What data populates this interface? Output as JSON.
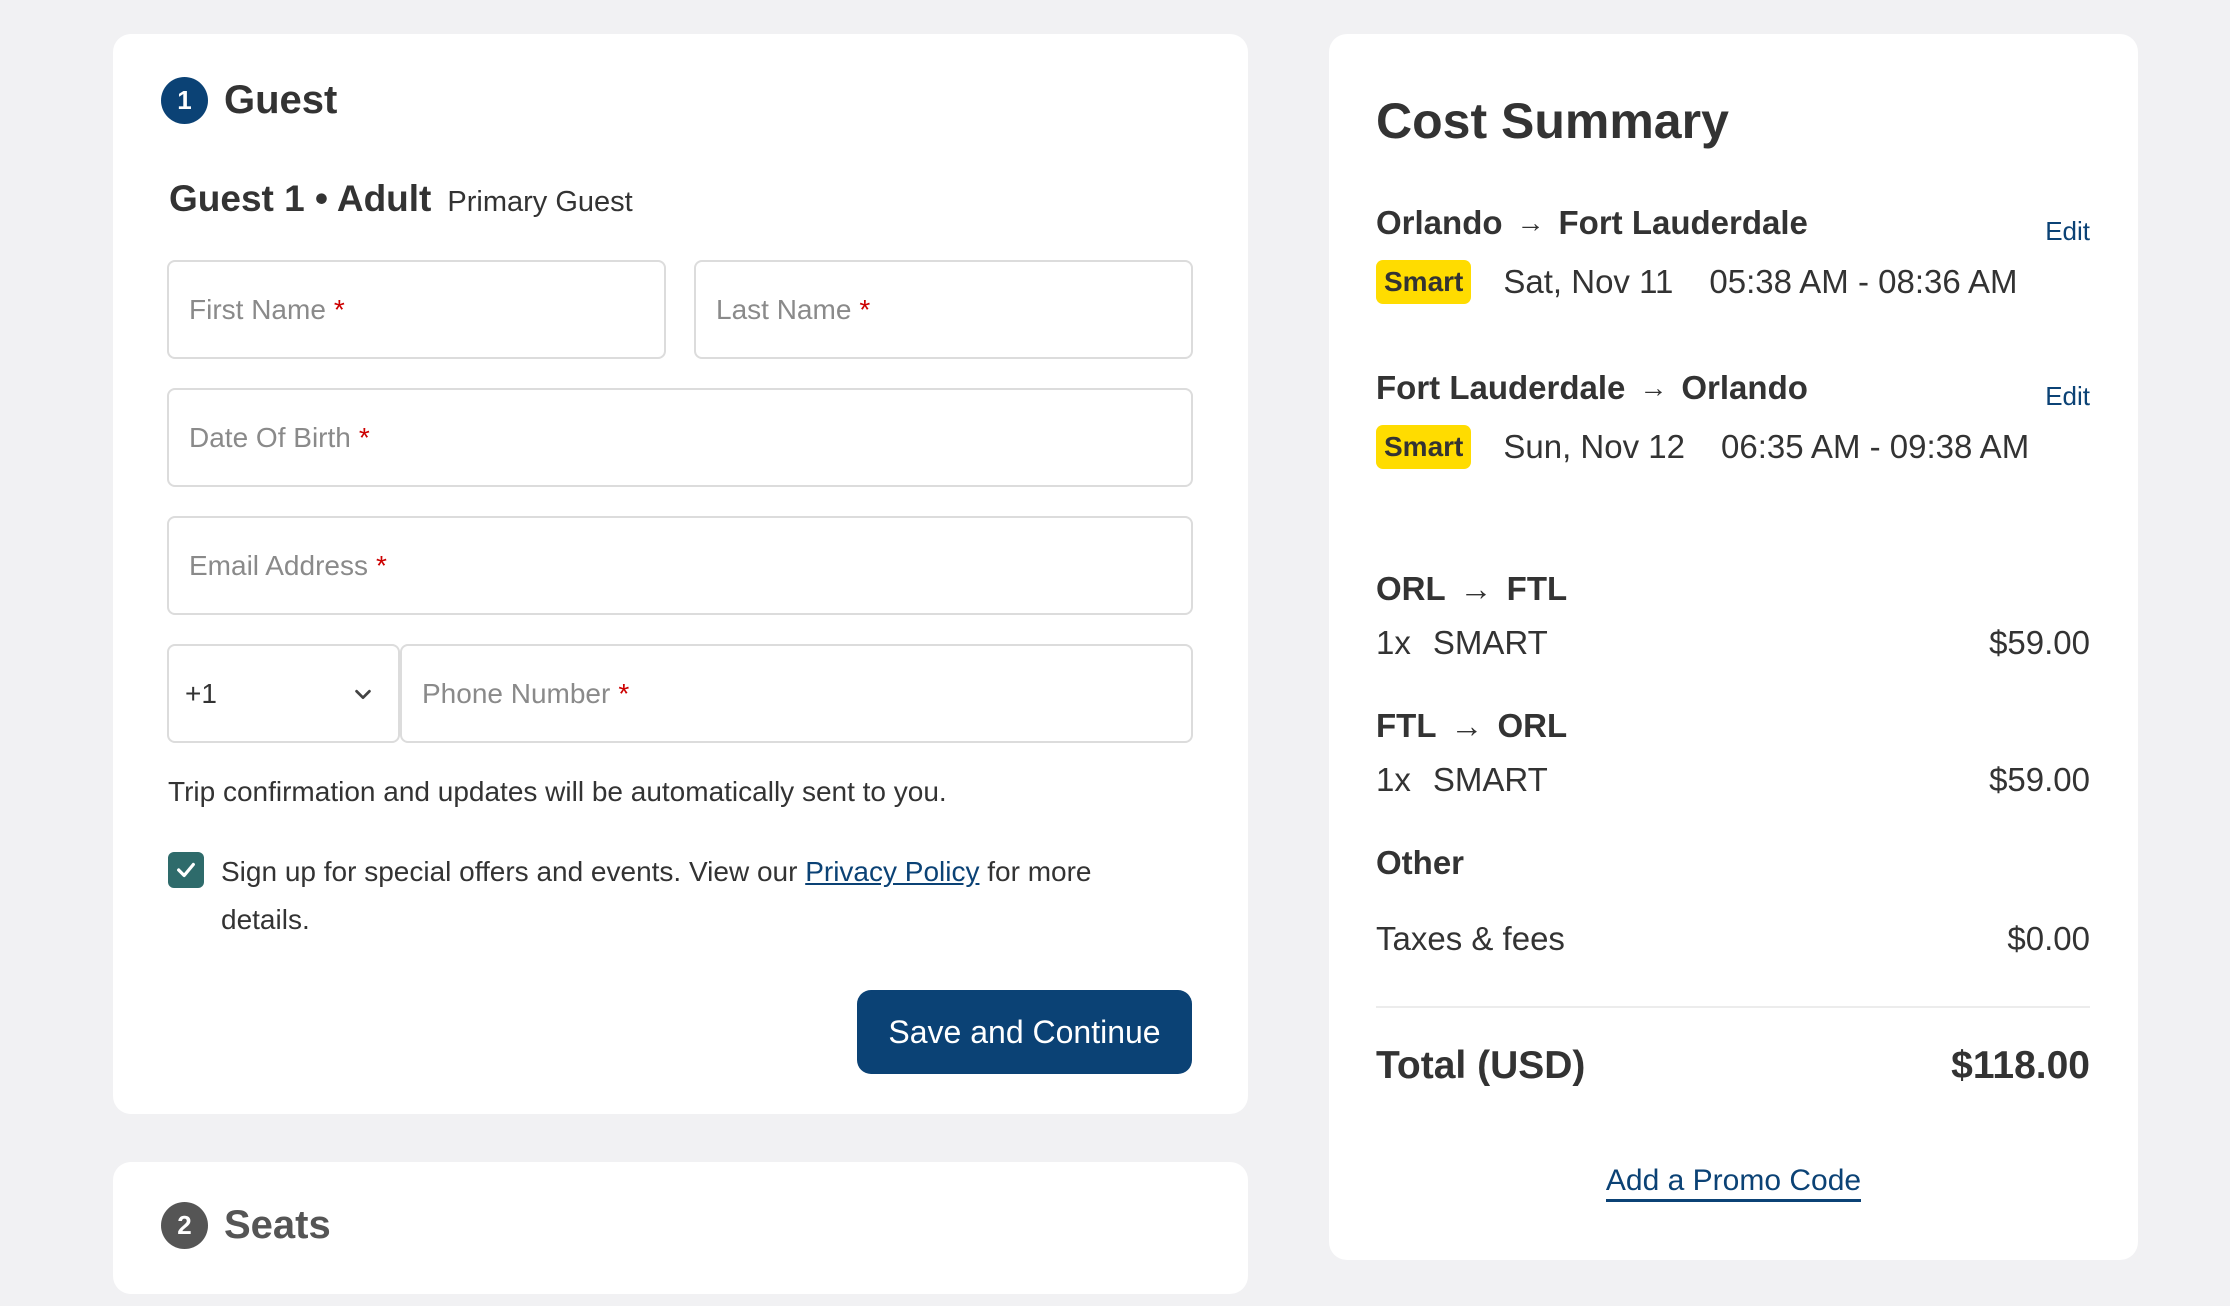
{
  "guest_section": {
    "step_number": "1",
    "title": "Guest",
    "guest_label": "Guest 1 • Adult",
    "guest_tag": "Primary Guest",
    "fields": {
      "first_name": {
        "placeholder": "First Name",
        "value": "",
        "required": true
      },
      "last_name": {
        "placeholder": "Last Name",
        "value": "",
        "required": true
      },
      "date_of_birth": {
        "placeholder": "Date Of Birth",
        "value": "",
        "required": true
      },
      "email": {
        "placeholder": "Email Address",
        "value": "",
        "required": true
      },
      "country_code": {
        "selected": "+1"
      },
      "phone": {
        "placeholder": "Phone Number",
        "value": "",
        "required": true
      }
    },
    "required_marker": "*",
    "note": "Trip confirmation and updates will be automatically sent to you.",
    "optin": {
      "checked": true,
      "text_before": "Sign up for special offers and events. View our ",
      "link_text": "Privacy Policy",
      "text_after": " for more details."
    },
    "save_button": "Save and Continue"
  },
  "seats_section": {
    "step_number": "2",
    "title": "Seats"
  },
  "cost_summary": {
    "title": "Cost Summary",
    "legs": [
      {
        "from": "Orlando",
        "to": "Fort Lauderdale",
        "edit_label": "Edit",
        "fare_badge": "Smart",
        "date": "Sat, Nov 11",
        "time": "05:38 AM - 08:36 AM"
      },
      {
        "from": "Fort Lauderdale",
        "to": "Orlando",
        "edit_label": "Edit",
        "fare_badge": "Smart",
        "date": "Sun, Nov 12",
        "time": "06:35 AM - 09:38 AM"
      }
    ],
    "line_items": [
      {
        "from": "ORL",
        "to": "FTL",
        "qty": "1x",
        "fare": "SMART",
        "price": "$59.00"
      },
      {
        "from": "FTL",
        "to": "ORL",
        "qty": "1x",
        "fare": "SMART",
        "price": "$59.00"
      }
    ],
    "other": {
      "heading": "Other",
      "label": "Taxes & fees",
      "price": "$0.00"
    },
    "total": {
      "label": "Total (USD)",
      "value": "$118.00"
    },
    "promo_link": "Add a Promo Code"
  },
  "colors": {
    "brand_navy": "#0b4275",
    "badge_yellow": "#ffdc00",
    "checkbox_teal": "#2e6b6b",
    "required_red": "#cc0000"
  }
}
